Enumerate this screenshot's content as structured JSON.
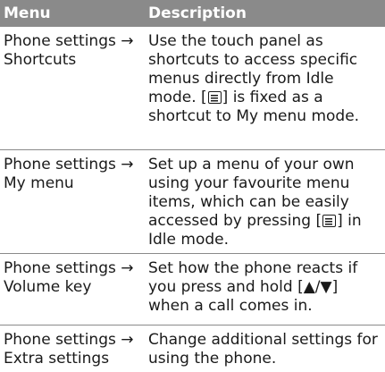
{
  "header": {
    "menu": "Menu",
    "description": "Description"
  },
  "rows": [
    {
      "menu": "Phone settings →\nShortcuts",
      "desc_a": "Use the touch panel as shortcuts to access specific menus directly from Idle mode. [",
      "icon": "menu-key-icon",
      "desc_b": "] is fixed as a shortcut to My menu mode."
    },
    {
      "menu": "Phone settings →\nMy menu",
      "desc_a": "Set up a menu of your own using your favourite menu items, which can be easily accessed by pressing [",
      "icon": "menu-key-icon",
      "desc_b": "] in Idle mode."
    },
    {
      "menu": "Phone settings →\nVolume key",
      "desc": "Set how the phone reacts if you press and hold [▲/▼] when a call comes in."
    },
    {
      "menu": "Phone settings →\nExtra settings",
      "desc": "Change additional settings for using the phone."
    }
  ]
}
